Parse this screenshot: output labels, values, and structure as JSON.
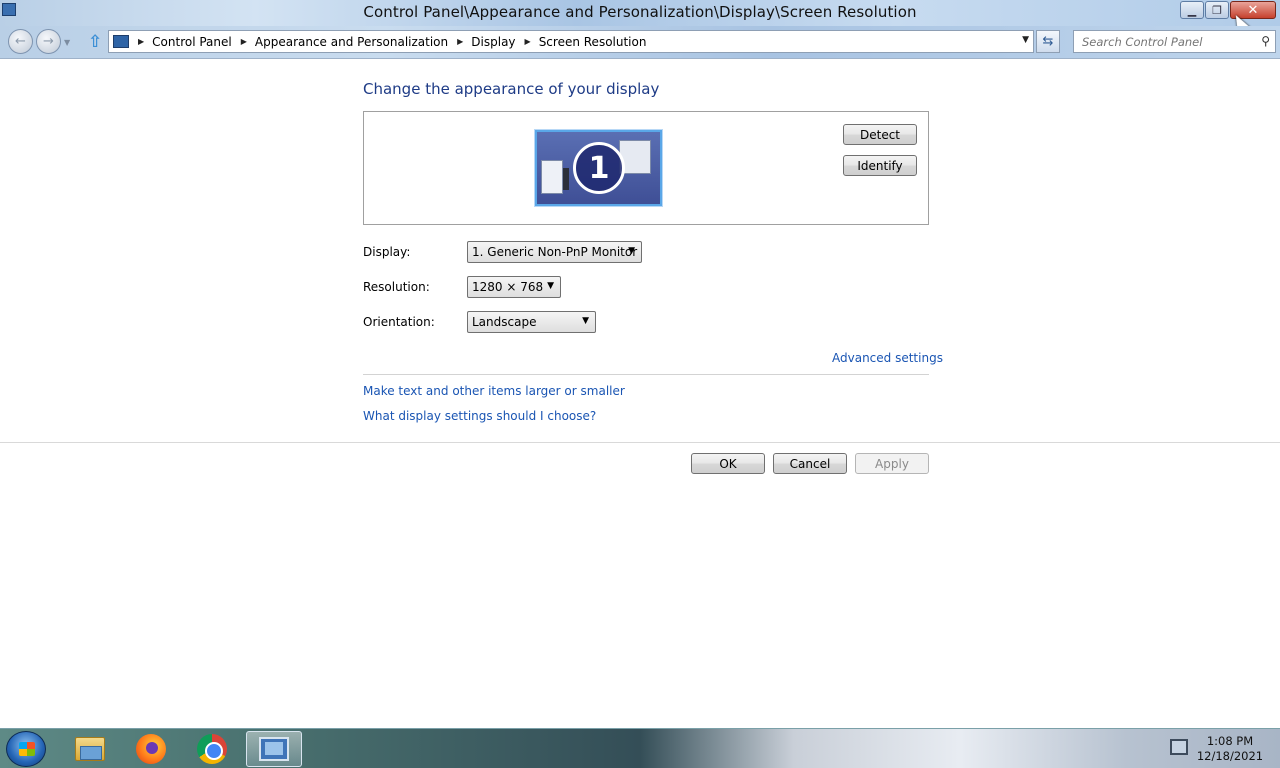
{
  "window": {
    "title": "Control Panel\\Appearance and Personalization\\Display\\Screen Resolution",
    "controls": {
      "minimize_icon": "minimize-icon",
      "maximize_icon": "restore-icon",
      "close_label": "✕"
    }
  },
  "navbar": {
    "back_glyph": "←",
    "forward_glyph": "→",
    "up_glyph": "⇧",
    "breadcrumbs": [
      "Control Panel",
      "Appearance and Personalization",
      "Display",
      "Screen Resolution"
    ],
    "refresh_glyph": "⇆",
    "search_placeholder": "Search Control Panel",
    "search_glyph": "⚲"
  },
  "main": {
    "heading": "Change the appearance of your display",
    "monitor_number": "1",
    "detect_label": "Detect",
    "identify_label": "Identify",
    "display": {
      "label": "Display:",
      "value": "1. Generic Non-PnP Monitor"
    },
    "resolution": {
      "label": "Resolution:",
      "value": "1280 × 768"
    },
    "orientation": {
      "label": "Orientation:",
      "value": "Landscape"
    },
    "advanced_link": "Advanced settings",
    "larger_link": "Make text and other items larger or smaller",
    "choose_link": "What display settings should I choose?",
    "ok_label": "OK",
    "cancel_label": "Cancel",
    "apply_label": "Apply"
  },
  "taskbar": {
    "items": [
      "windows-explorer",
      "firefox",
      "chrome",
      "control-panel"
    ],
    "clock_time": "1:08 PM",
    "clock_date": "12/18/2021"
  },
  "colors": {
    "link": "#1a55b3",
    "heading": "#1e3b86"
  }
}
